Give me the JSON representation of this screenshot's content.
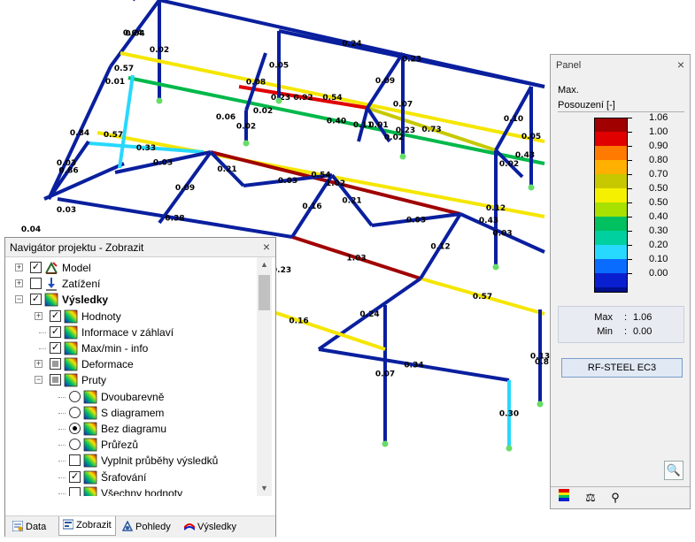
{
  "model_view": {
    "members": [
      {
        "from": [
          150,
          0
        ],
        "to": [
          180,
          -30
        ],
        "value": null,
        "color": "#0a1f9e"
      },
      {
        "from": [
          180,
          0
        ],
        "to": [
          615,
          98
        ],
        "value": "0.24",
        "color": "#0a1f9e"
      },
      {
        "from": [
          180,
          0
        ],
        "to": [
          180,
          112
        ],
        "value": "0.02",
        "color": "#0a1f9e"
      },
      {
        "from": [
          180,
          0
        ],
        "to": [
          125,
          75
        ],
        "value": "0.04",
        "color": "#0a1f9e"
      },
      {
        "from": [
          125,
          75
        ],
        "to": [
          55,
          225
        ],
        "value": "0.84",
        "color": "#0a1f9e"
      },
      {
        "from": [
          136,
          60
        ],
        "to": [
          615,
          160
        ],
        "value": "0.54",
        "color": "#f5e600"
      },
      {
        "from": [
          145,
          88
        ],
        "to": [
          615,
          185
        ],
        "value": "0.40",
        "color": "#00b84a"
      },
      {
        "from": [
          270,
          98
        ],
        "to": [
          415,
          122
        ],
        "value": "0.92",
        "color": "#e00000"
      },
      {
        "from": [
          415,
          122
        ],
        "to": [
          560,
          170
        ],
        "value": "0.73",
        "color": "#c8c800"
      },
      {
        "from": [
          110,
          150
        ],
        "to": [
          615,
          245
        ],
        "value": "0.54",
        "color": "#f5e600"
      },
      {
        "from": [
          100,
          162
        ],
        "to": [
          230,
          172
        ],
        "value": "0.33",
        "color": "#27d8ff"
      },
      {
        "from": [
          238,
          172
        ],
        "to": [
          520,
          242
        ],
        "value": "1.02",
        "color": "#a00000"
      },
      {
        "from": [
          65,
          225
        ],
        "to": [
          330,
          268
        ],
        "value": "0.38",
        "color": "#0a1f9e"
      },
      {
        "from": [
          330,
          268
        ],
        "to": [
          475,
          315
        ],
        "value": "1.03",
        "color": "#a00000"
      },
      {
        "from": [
          475,
          315
        ],
        "to": [
          615,
          355
        ],
        "value": "0.57",
        "color": "#f5e600"
      },
      {
        "from": [
          475,
          315
        ],
        "to": [
          360,
          395
        ],
        "value": "0.24",
        "color": "#0a1f9e"
      },
      {
        "from": [
          360,
          395
        ],
        "to": [
          575,
          430
        ],
        "value": "0.34",
        "color": "#0a1f9e"
      },
      {
        "from": [
          238,
          172
        ],
        "to": [
          275,
          210
        ],
        "value": "0.21",
        "color": "#0a1f9e"
      },
      {
        "from": [
          275,
          210
        ],
        "to": [
          375,
          198
        ],
        "value": "0.03",
        "color": "#0a1f9e"
      },
      {
        "from": [
          375,
          198
        ],
        "to": [
          330,
          268
        ],
        "value": "0.16",
        "color": "#0a1f9e"
      },
      {
        "from": [
          375,
          198
        ],
        "to": [
          420,
          255
        ],
        "value": "0.21",
        "color": "#0a1f9e"
      },
      {
        "from": [
          420,
          255
        ],
        "to": [
          520,
          242
        ],
        "value": "0.03",
        "color": "#0a1f9e"
      },
      {
        "from": [
          520,
          242
        ],
        "to": [
          475,
          315
        ],
        "value": "0.12",
        "color": "#0a1f9e"
      },
      {
        "from": [
          520,
          242
        ],
        "to": [
          615,
          285
        ],
        "value": "0.03",
        "color": "#0a1f9e"
      },
      {
        "from": [
          238,
          172
        ],
        "to": [
          180,
          252
        ],
        "value": "0.09",
        "color": "#0a1f9e"
      },
      {
        "from": [
          130,
          195
        ],
        "to": [
          238,
          172
        ],
        "value": "0.03",
        "color": "#0a1f9e"
      },
      {
        "from": [
          50,
          225
        ],
        "to": [
          140,
          185
        ],
        "value": null,
        "color": "#0a1f9e"
      },
      {
        "from": [
          55,
          225
        ],
        "to": [
          100,
          160
        ],
        "value": "0.86",
        "color": "#0a1f9e"
      },
      {
        "from": [
          315,
          35
        ],
        "to": [
          315,
          112
        ],
        "value": "0.05",
        "color": "#0a1f9e"
      },
      {
        "from": [
          300,
          60
        ],
        "to": [
          278,
          125
        ],
        "value": "0.08",
        "color": "#0a1f9e"
      },
      {
        "from": [
          455,
          60
        ],
        "to": [
          455,
          175
        ],
        "value": "0.07",
        "color": "#0a1f9e"
      },
      {
        "from": [
          455,
          60
        ],
        "to": [
          415,
          122
        ],
        "value": "0.09",
        "color": "#0a1f9e"
      },
      {
        "from": [
          315,
          35
        ],
        "to": [
          615,
          98
        ],
        "value": "0.23",
        "color": "#0a1f9e"
      },
      {
        "from": [
          600,
          98
        ],
        "to": [
          600,
          210
        ],
        "value": "0.05",
        "color": "#0a1f9e"
      },
      {
        "from": [
          600,
          98
        ],
        "to": [
          560,
          170
        ],
        "value": "0.10",
        "color": "#0a1f9e"
      },
      {
        "from": [
          415,
          122
        ],
        "to": [
          405,
          160
        ],
        "value": "0.11",
        "color": "#0a1f9e"
      },
      {
        "from": [
          415,
          122
        ],
        "to": [
          440,
          160
        ],
        "value": "0.01",
        "color": "#0a1f9e"
      },
      {
        "from": [
          278,
          125
        ],
        "to": [
          278,
          160
        ],
        "value": "0.02",
        "color": "#0a1f9e"
      },
      {
        "from": [
          150,
          85
        ],
        "to": [
          135,
          190
        ],
        "value": null,
        "color": "#27d8ff"
      },
      {
        "from": [
          560,
          170
        ],
        "to": [
          560,
          300
        ],
        "value": "0.12",
        "color": "#0a1f9e"
      },
      {
        "from": [
          560,
          170
        ],
        "to": [
          590,
          200
        ],
        "value": "0.02",
        "color": "#0a1f9e"
      },
      {
        "from": [
          435,
          345
        ],
        "to": [
          435,
          500
        ],
        "value": "0.07",
        "color": "#0a1f9e"
      },
      {
        "from": [
          575,
          430
        ],
        "to": [
          575,
          505
        ],
        "value": "0.30",
        "color": "#27d8ff"
      },
      {
        "from": [
          240,
          330
        ],
        "to": [
          435,
          395
        ],
        "value": "0.16",
        "color": "#f5e600"
      },
      {
        "from": [
          610,
          350
        ],
        "to": [
          610,
          455
        ],
        "value": "0.13",
        "color": "#0a1f9e"
      }
    ],
    "extra_labels": [
      {
        "text": "0.04",
        "pos": [
          150,
          40
        ]
      },
      {
        "text": "0.57",
        "pos": [
          140,
          80
        ]
      },
      {
        "text": "0.01",
        "pos": [
          130,
          95
        ]
      },
      {
        "text": "0.23",
        "pos": [
          317,
          113
        ]
      },
      {
        "text": "0.06",
        "pos": [
          255,
          135
        ]
      },
      {
        "text": "0.02",
        "pos": [
          297,
          128
        ]
      },
      {
        "text": "0.23",
        "pos": [
          458,
          150
        ]
      },
      {
        "text": "0.57",
        "pos": [
          128,
          155
        ]
      },
      {
        "text": "0.02",
        "pos": [
          445,
          158
        ]
      },
      {
        "text": "0.43",
        "pos": [
          593,
          178
        ]
      },
      {
        "text": "0.03",
        "pos": [
          75,
          187
        ]
      },
      {
        "text": "0.03",
        "pos": [
          75,
          240
        ]
      },
      {
        "text": "0.04",
        "pos": [
          35,
          262
        ]
      },
      {
        "text": "0.43",
        "pos": [
          552,
          252
        ]
      },
      {
        "text": "0.23",
        "pos": [
          318,
          308
        ]
      },
      {
        "text": "0.8",
        "pos": [
          612,
          412
        ]
      }
    ]
  },
  "panel": {
    "title": "Panel",
    "header_line1": "Max.",
    "header_line2": "Posouzení [-]",
    "legend": [
      {
        "value": "1.06",
        "color": "#a00000"
      },
      {
        "value": "1.00",
        "color": "#e00000"
      },
      {
        "value": "0.90",
        "color": "#ff7a00"
      },
      {
        "value": "0.80",
        "color": "#ffb000"
      },
      {
        "value": "0.70",
        "color": "#c8c800"
      },
      {
        "value": "0.50",
        "color": "#f5f000"
      },
      {
        "value": "0.50",
        "color": "#a8e000"
      },
      {
        "value": "0.40",
        "color": "#00c060"
      },
      {
        "value": "0.30",
        "color": "#00d0a0"
      },
      {
        "value": "0.20",
        "color": "#27d8ff"
      },
      {
        "value": "0.10",
        "color": "#0a6cff"
      },
      {
        "value": "0.00",
        "color": "#0a1fd0"
      }
    ],
    "legend_bottom_color": "#00108a",
    "max_label": "Max",
    "max_value": "1.06",
    "min_label": "Min",
    "min_value": "0.00",
    "button_label": "RF-STEEL EC3"
  },
  "navigator": {
    "title": "Navigátor projektu - Zobrazit",
    "items": [
      {
        "label": "Model",
        "level": 0,
        "expander": "+",
        "check": "checked",
        "bold": false,
        "icon": "model-icon"
      },
      {
        "label": "Zatížení",
        "level": 0,
        "expander": "+",
        "check": "unchecked",
        "bold": false,
        "icon": "load-icon"
      },
      {
        "label": "Výsledky",
        "level": 0,
        "expander": "-",
        "check": "checked",
        "bold": true,
        "icon": "results-icon"
      },
      {
        "label": "Hodnoty",
        "level": 1,
        "expander": "+",
        "check": "checked",
        "bold": false,
        "icon": "results-icon"
      },
      {
        "label": "Informace v záhlaví",
        "level": 1,
        "expander": null,
        "check": "checked",
        "bold": false,
        "icon": "results-icon"
      },
      {
        "label": "Max/min - info",
        "level": 1,
        "expander": null,
        "check": "checked",
        "bold": false,
        "icon": "results-icon"
      },
      {
        "label": "Deformace",
        "level": 1,
        "expander": "+",
        "check": "partial",
        "bold": false,
        "icon": "results-icon"
      },
      {
        "label": "Pruty",
        "level": 1,
        "expander": "-",
        "check": "partial",
        "bold": false,
        "icon": "results-icon"
      },
      {
        "label": "Dvoubarevně",
        "level": 2,
        "expander": null,
        "radio": "off",
        "bold": false,
        "icon": "results-icon"
      },
      {
        "label": "S diagramem",
        "level": 2,
        "expander": null,
        "radio": "off",
        "bold": false,
        "icon": "results-icon"
      },
      {
        "label": "Bez diagramu",
        "level": 2,
        "expander": null,
        "radio": "on",
        "bold": false,
        "icon": "results-icon"
      },
      {
        "label": "Průřezů",
        "level": 2,
        "expander": null,
        "radio": "off",
        "bold": false,
        "icon": "results-icon"
      },
      {
        "label": "Vyplnit průběhy výsledků",
        "level": 2,
        "expander": null,
        "check": "unchecked",
        "bold": false,
        "icon": "results-icon"
      },
      {
        "label": "Šrafování",
        "level": 2,
        "expander": null,
        "check": "checked",
        "bold": false,
        "icon": "results-icon"
      },
      {
        "label": "Všechny hodnoty",
        "level": 2,
        "expander": null,
        "check": "unchecked",
        "bold": false,
        "icon": "results-icon"
      }
    ],
    "tabs": [
      {
        "label": "Data",
        "icon": "data-icon",
        "active": false
      },
      {
        "label": "Zobrazit",
        "icon": "display-icon",
        "active": true
      },
      {
        "label": "Pohledy",
        "icon": "views-icon",
        "active": false
      },
      {
        "label": "Výsledky",
        "icon": "results-tab-icon",
        "active": false
      }
    ]
  }
}
